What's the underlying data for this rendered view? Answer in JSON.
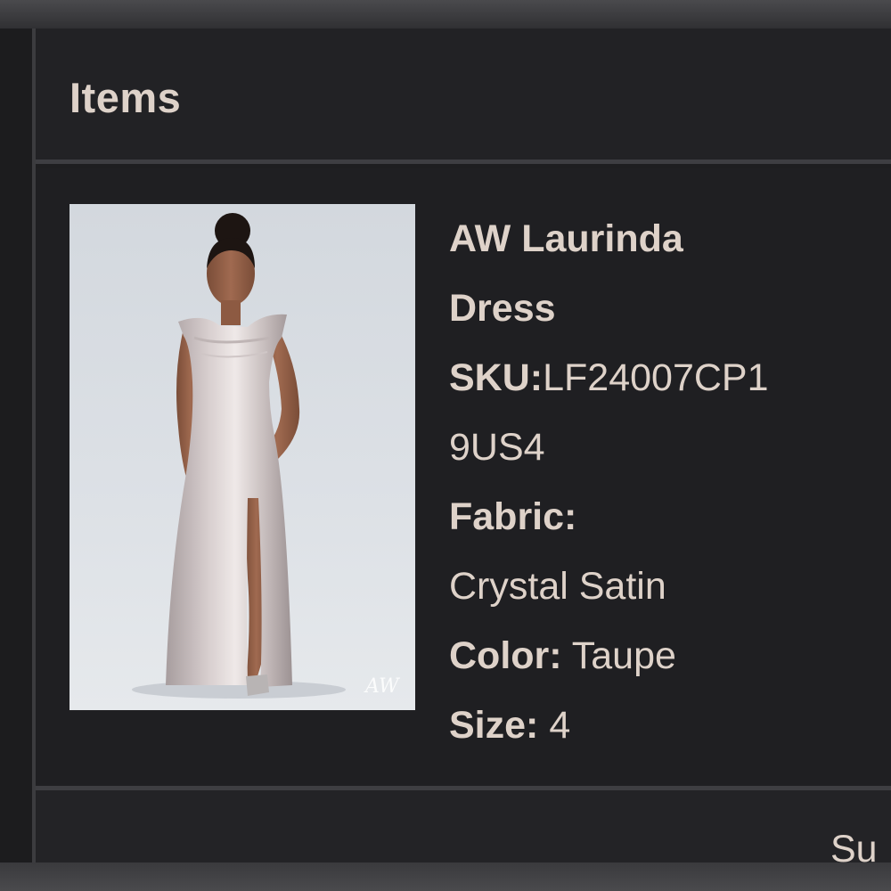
{
  "header": {
    "title": "Items"
  },
  "item": {
    "name_line1": "AW Laurinda",
    "name_line2": "Dress",
    "sku_label": "SKU:",
    "sku_value_line1": "LF24007CP1",
    "sku_value_line2": "9US4",
    "fabric_label": "Fabric:",
    "fabric_value": "Crystal Satin",
    "color_label": "Color:",
    "color_value": "Taupe",
    "size_label": "Size:",
    "size_value": "4",
    "image_watermark": "AW"
  },
  "footer": {
    "partial_label": "Su"
  },
  "colors": {
    "text": "#ded2c9",
    "panel": "#1f1f22",
    "divider": "#3e3e42"
  }
}
